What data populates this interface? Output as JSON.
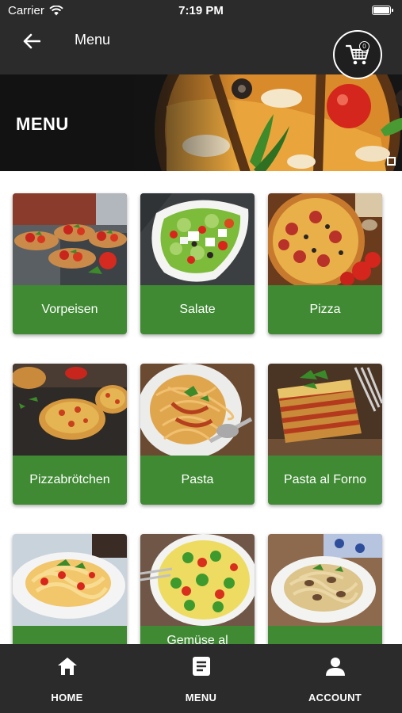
{
  "status_bar": {
    "carrier": "Carrier",
    "time": "7:19 PM"
  },
  "app_bar": {
    "title": "Menu",
    "cart_count": "0"
  },
  "banner": {
    "title": "MENU"
  },
  "categories": [
    {
      "label": "Vorpeisen",
      "image": "bruschetta"
    },
    {
      "label": "Salate",
      "image": "salad"
    },
    {
      "label": "Pizza",
      "image": "pizza"
    },
    {
      "label": "Pizzabrötchen",
      "image": "pizza-rolls"
    },
    {
      "label": "Pasta",
      "image": "spaghetti"
    },
    {
      "label": "Pasta al Forno",
      "image": "lasagna"
    },
    {
      "label": "",
      "image": "pappardelle"
    },
    {
      "label": "Gemüse al",
      "image": "vegetable-gratin"
    },
    {
      "label": "",
      "image": "tagliatelle"
    }
  ],
  "bottom_nav": [
    {
      "label": "HOME",
      "icon": "home-icon"
    },
    {
      "label": "MENU",
      "icon": "menu-book-icon"
    },
    {
      "label": "ACCOUNT",
      "icon": "account-icon"
    }
  ],
  "colors": {
    "header": "#2b2b2b",
    "card_label": "#3f8a33",
    "background": "#ffffff"
  }
}
